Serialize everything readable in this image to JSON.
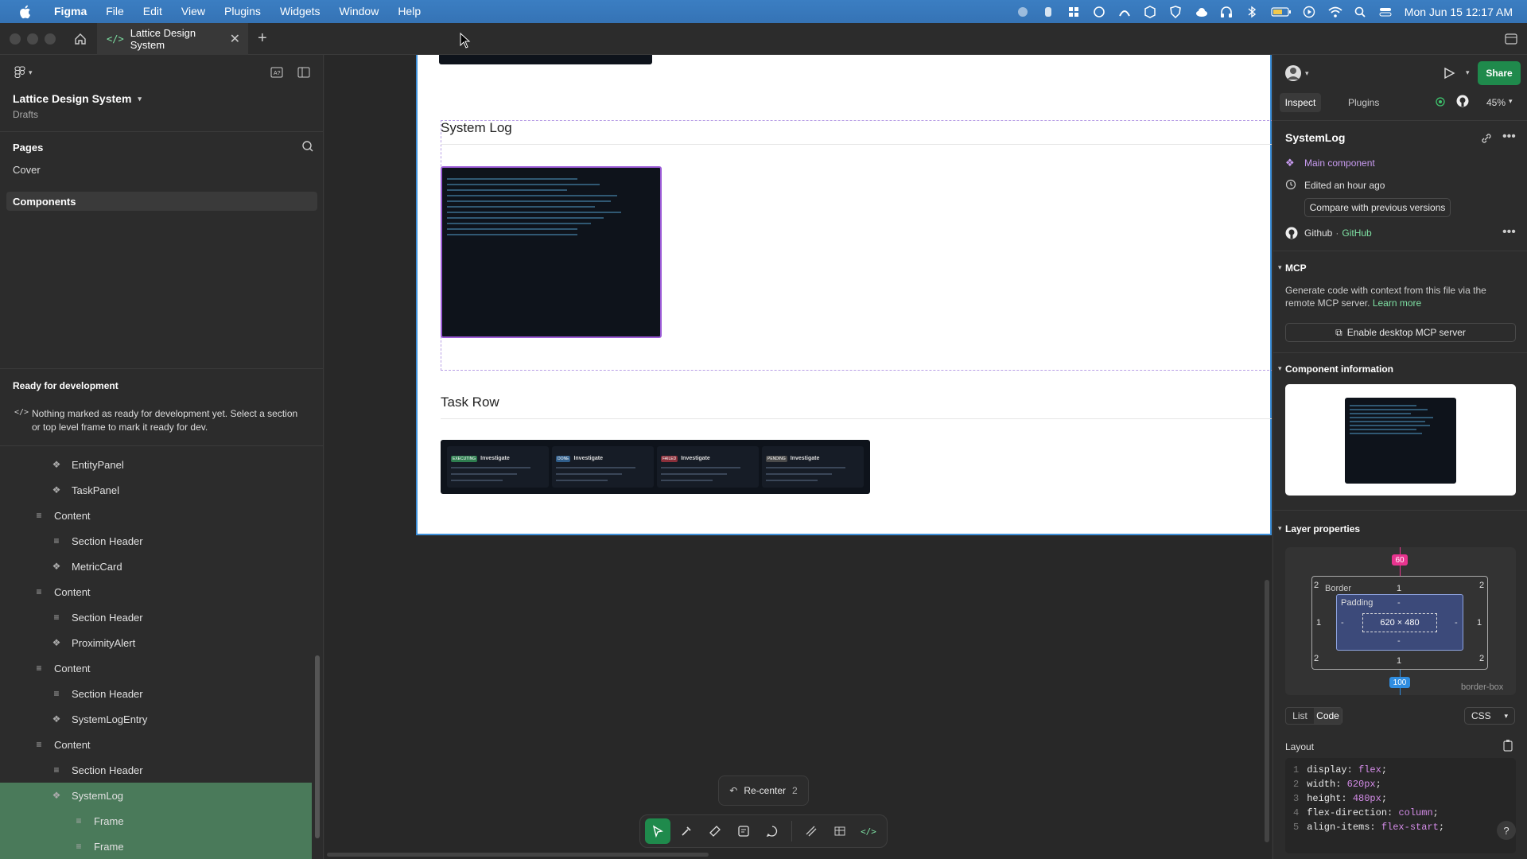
{
  "menubar": {
    "app": "Figma",
    "items": [
      "File",
      "Edit",
      "View",
      "Plugins",
      "Widgets",
      "Window",
      "Help"
    ],
    "clock": "Mon Jun 15  12:17 AM"
  },
  "tabs": [
    {
      "label": "Lattice Design System"
    }
  ],
  "file": {
    "name": "Lattice Design System",
    "location": "Drafts"
  },
  "pages": {
    "title": "Pages",
    "items": [
      {
        "label": "Cover"
      },
      {
        "label": "Components"
      }
    ]
  },
  "ready": {
    "title": "Ready for development",
    "message": "Nothing marked as ready for development yet. Select a section or top level frame to mark it ready for dev."
  },
  "layers": [
    {
      "label": "EntityPanel",
      "icon": "component-icon"
    },
    {
      "label": "TaskPanel",
      "icon": "component-icon"
    },
    {
      "label": "Content",
      "icon": "frame-stack-icon"
    },
    {
      "label": "Section Header",
      "icon": "frame-stack-icon"
    },
    {
      "label": "MetricCard",
      "icon": "component-icon"
    },
    {
      "label": "Content",
      "icon": "frame-stack-icon"
    },
    {
      "label": "Section Header",
      "icon": "frame-stack-icon"
    },
    {
      "label": "ProximityAlert",
      "icon": "component-icon"
    },
    {
      "label": "Content",
      "icon": "frame-stack-icon"
    },
    {
      "label": "Section Header",
      "icon": "frame-stack-icon"
    },
    {
      "label": "SystemLogEntry",
      "icon": "component-icon"
    },
    {
      "label": "Content",
      "icon": "frame-stack-icon"
    },
    {
      "label": "Section Header",
      "icon": "frame-stack-icon"
    },
    {
      "label": "SystemLog",
      "icon": "component-icon"
    },
    {
      "label": "Frame",
      "icon": "frame-stack-icon"
    },
    {
      "label": "Frame",
      "icon": "frame-stack-icon"
    }
  ],
  "canvas": {
    "system_log_title": "System Log",
    "task_row_title": "Task Row",
    "task_cards": [
      {
        "status": "EXECUTING",
        "title": "Investigate",
        "status_color": "#2e7d4f"
      },
      {
        "status": "DONE",
        "title": "Investigate",
        "status_color": "#2f5d8a"
      },
      {
        "status": "FAILED",
        "title": "Investigate",
        "status_color": "#8a2f3a"
      },
      {
        "status": "PENDING",
        "title": "Investigate",
        "status_color": "#4a4a4a"
      }
    ],
    "recenter_label": "Re-center",
    "recenter_count": "2"
  },
  "right_panel": {
    "tabs": [
      "Inspect",
      "Plugins"
    ],
    "zoom": "45%",
    "share": "Share",
    "component_name": "SystemLog",
    "main_component": "Main component",
    "edited": "Edited an hour ago",
    "compare": "Compare with previous versions",
    "github_label": "Github",
    "github_link": "GitHub",
    "mcp": {
      "title": "MCP",
      "desc": "Generate code with context from this file via the remote MCP server.",
      "learn_more": "Learn more",
      "button": "Enable desktop MCP server"
    },
    "component_info_title": "Component information",
    "layer_props_title": "Layer properties",
    "box": {
      "margin_top": "60",
      "margin_bottom": "100",
      "border_label": "Border",
      "border_top": "1",
      "border_bottom": "1",
      "border_left": "1",
      "border_right": "1",
      "corner_tl": "2",
      "corner_tr": "2",
      "corner_bl": "2",
      "corner_br": "2",
      "padding_label": "Padding",
      "padding_value": "-",
      "size": "620 × 480",
      "box_sizing": "border-box"
    },
    "view_tabs": [
      "List",
      "Code"
    ],
    "lang": "CSS",
    "layout_title": "Layout",
    "code_lines": [
      {
        "n": "1",
        "prop": "display",
        "val": "flex"
      },
      {
        "n": "2",
        "prop": "width",
        "val": "620px"
      },
      {
        "n": "3",
        "prop": "height",
        "val": "480px"
      },
      {
        "n": "4",
        "prop": "flex-direction",
        "val": "column"
      },
      {
        "n": "5",
        "prop": "align-items",
        "val": "flex-start"
      }
    ]
  },
  "colors": {
    "accent_green": "#1f8a4c",
    "selection_purple": "#9b5bd6",
    "frame_blue": "#3d8fd9",
    "margin_pink": "#e8348f"
  }
}
